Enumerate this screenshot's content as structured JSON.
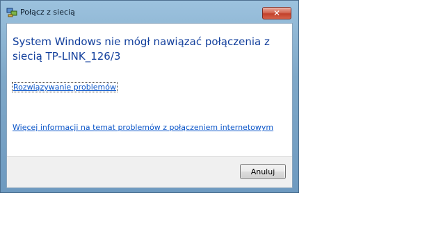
{
  "window": {
    "title": "Połącz z siecią",
    "close_label": "✕"
  },
  "content": {
    "headline": "System Windows nie mógł nawiązać połączenia z siecią TP-LINK_126/3",
    "troubleshoot_link": "Rozwiązywanie problemów",
    "more_info_link": "Więcej informacji na temat problemów z połączeniem internetowym"
  },
  "footer": {
    "cancel_label": "Anuluj"
  },
  "icons": {
    "title_icon": "network-connection-icon",
    "close": "close-icon"
  },
  "colors": {
    "headline": "#123f9c",
    "link": "#0a55c9",
    "close_button": "#c2412b"
  }
}
